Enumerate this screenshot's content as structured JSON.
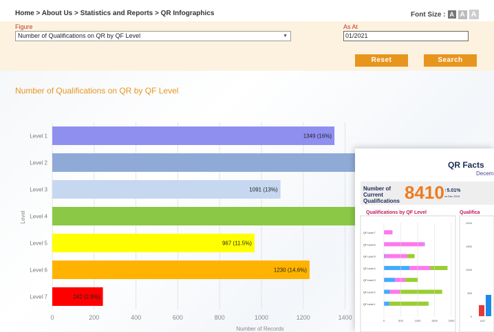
{
  "breadcrumb": "Home > About Us > Statistics and Reports > QR Infographics",
  "font_size": {
    "label": "Font Size :",
    "small": "A",
    "medium": "A",
    "large": "A"
  },
  "filters": {
    "figure_label": "Figure",
    "figure_value": "Number of Qualifications on QR by QF Level",
    "as_at_label": "As At",
    "as_at_value": "01/2021"
  },
  "buttons": {
    "reset": "Reset",
    "search": "Search"
  },
  "section_title": "Number of Qualifications on QR by QF Level",
  "chart_data": {
    "type": "bar",
    "orientation": "horizontal",
    "title": "Number of Qualifications on QR by QF Level",
    "ylabel": "Level",
    "xlabel": "Number of Records",
    "xlim": [
      0,
      1400
    ],
    "xticks": [
      0,
      200,
      400,
      600,
      800,
      1000,
      1200,
      1400
    ],
    "categories": [
      "Level 1",
      "Level 2",
      "Level 3",
      "Level 4",
      "Level 5",
      "Level 6",
      "Level 7"
    ],
    "values": [
      1349,
      1450,
      1091,
      1460,
      967,
      1230,
      242
    ],
    "data_labels": [
      "1349 (16%)",
      "",
      "1091 (13%)",
      "",
      "967 (11.5%)",
      "1230 (14.6%)",
      "242 (2.9%)"
    ],
    "colors": [
      "#8f8ff0",
      "#8faad6",
      "#c6d8f0",
      "#8ac846",
      "#ffff00",
      "#ffb300",
      "#ff0000"
    ],
    "grid": true,
    "legend": "none"
  },
  "infographic": {
    "title": "QR Facts",
    "subtitle": "Decem",
    "current_label": "Number of Current Qualifications",
    "current_value": "8410",
    "change_pct": "5.01%",
    "change_ref": "vs Dec 2019",
    "chart1_title": "Qualifications by QF Level",
    "chart2_title": "Qualifica",
    "mini_levels": [
      "QF Level 7",
      "QF Level 6",
      "QF Level 5",
      "QF Level 4",
      "QF Level 3",
      "QF Level 2",
      "QF Level 1"
    ],
    "mini_axis": [
      "0",
      "500",
      "1000",
      "1500",
      "2000"
    ],
    "right_axis": [
      "2000",
      "1500",
      "1000",
      "500",
      "0"
    ],
    "right_x": "A21"
  }
}
